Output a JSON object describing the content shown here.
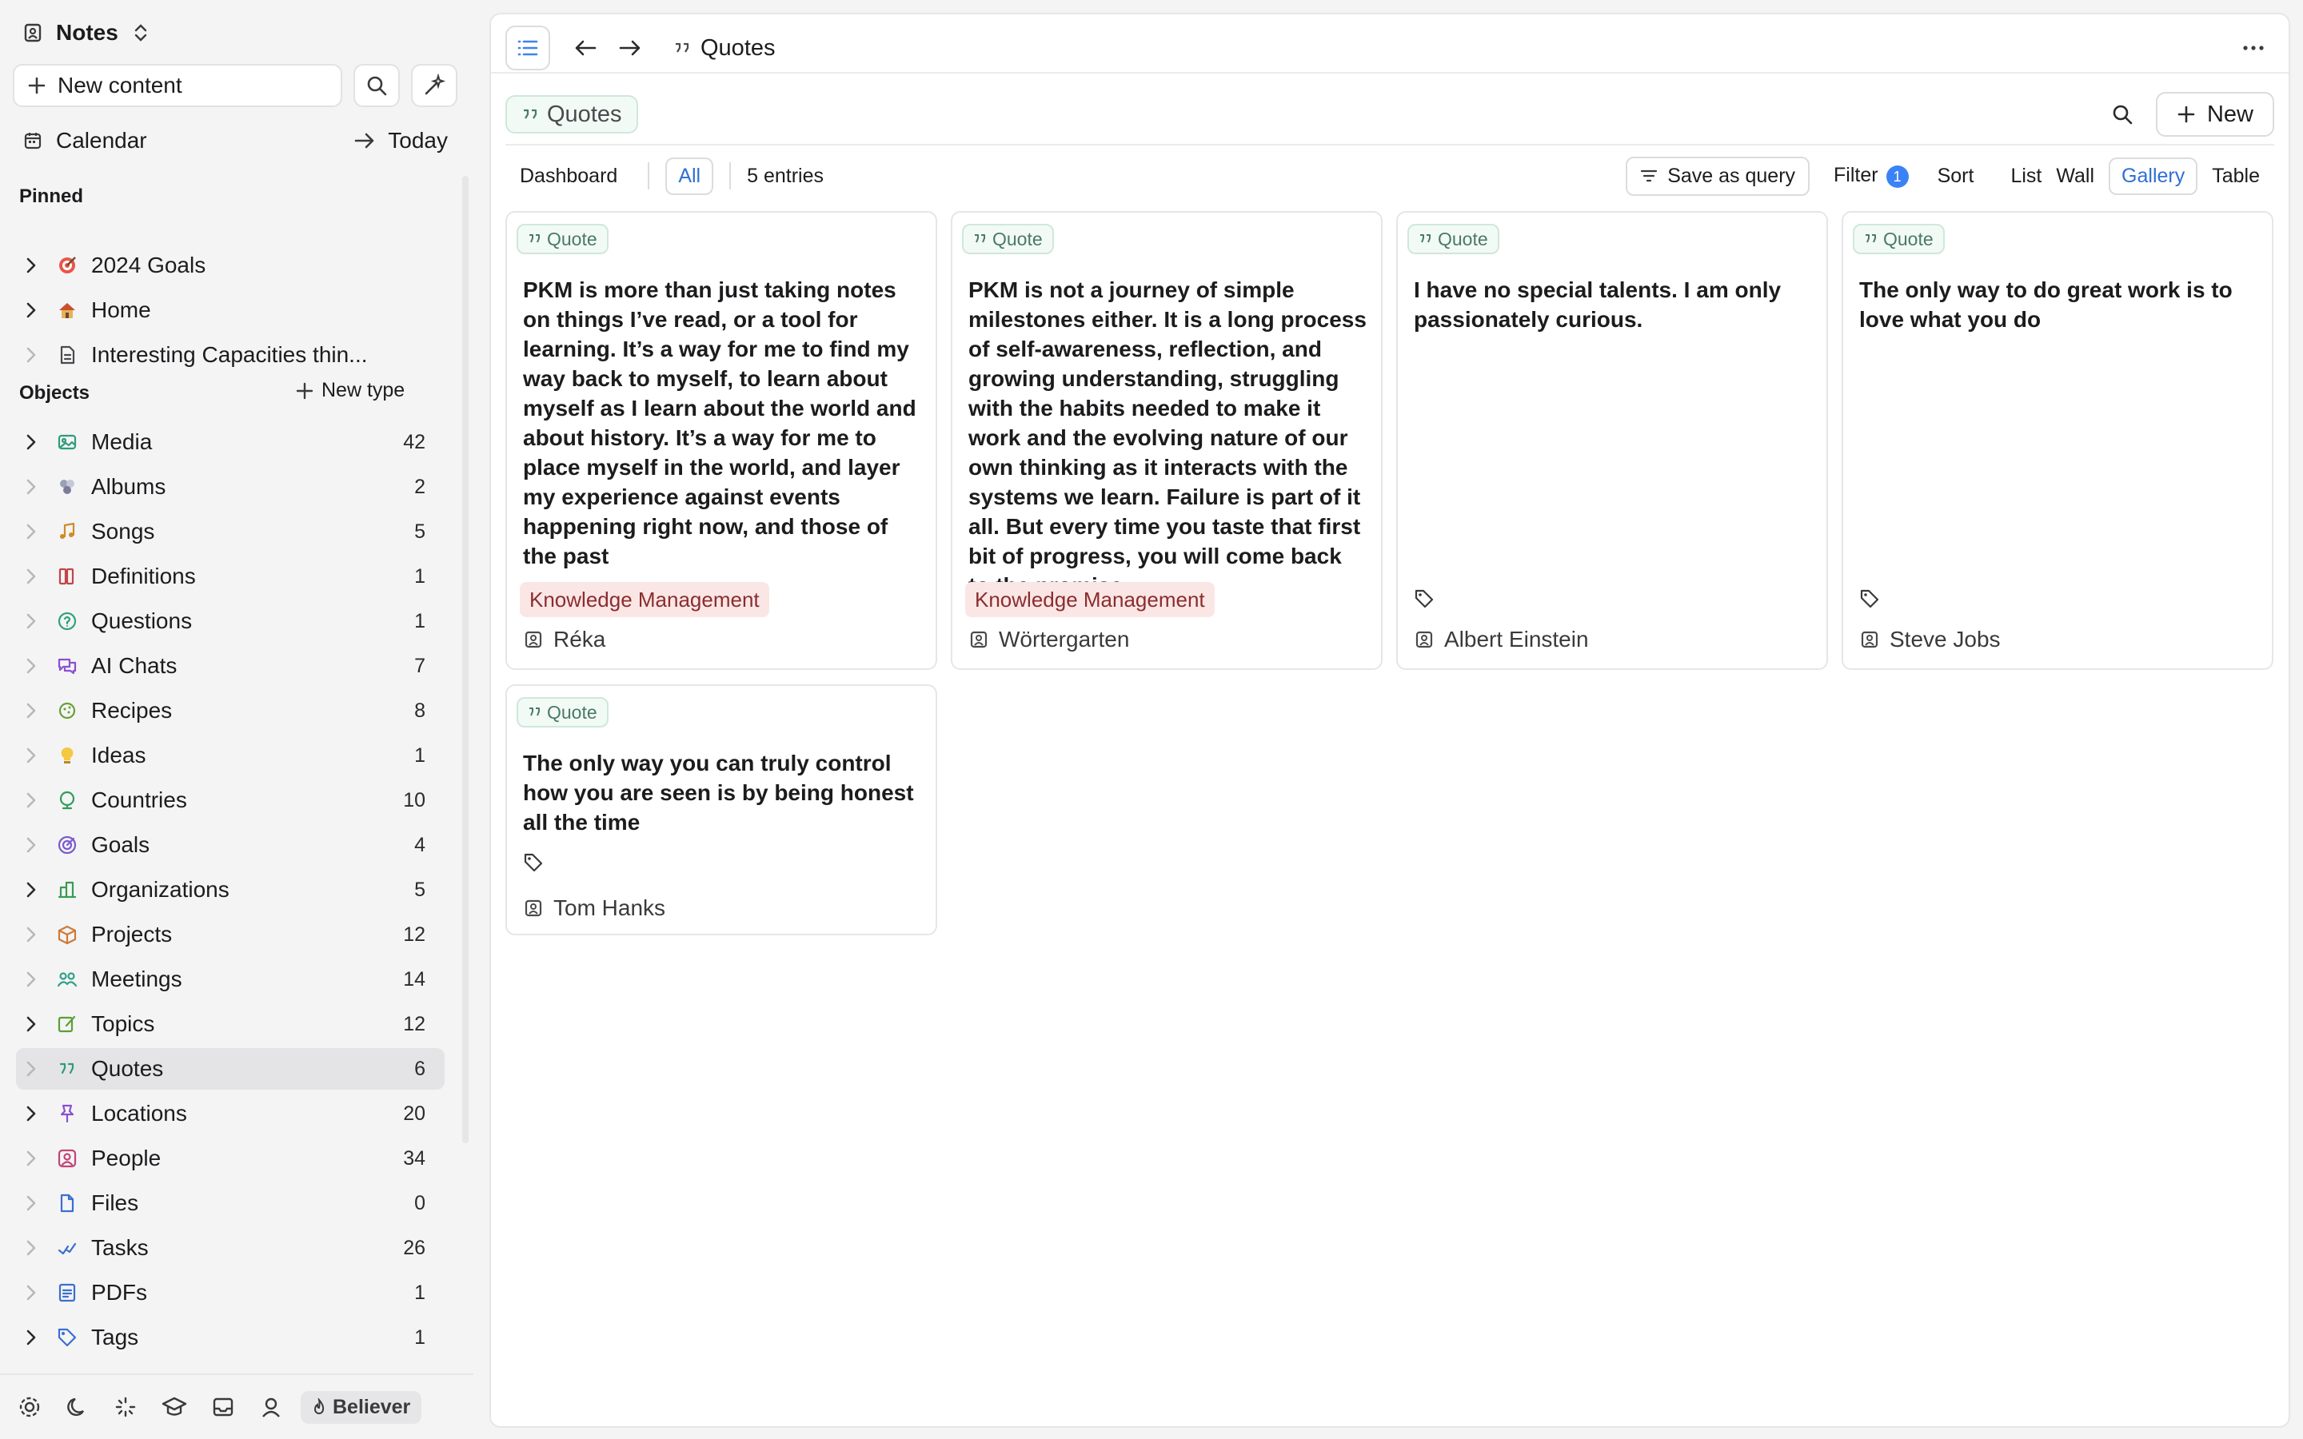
{
  "sidebar": {
    "app_title": "Notes",
    "new_content_label": "New content",
    "calendar_label": "Calendar",
    "today_label": "Today",
    "pinned_title": "Pinned",
    "pinned": [
      {
        "label": "2024 Goals",
        "icon": "target-icon"
      },
      {
        "label": "Home",
        "icon": "house-icon"
      },
      {
        "label": "Interesting Capacities thin...",
        "icon": "document-icon"
      }
    ],
    "objects_title": "Objects",
    "new_type_label": "New type",
    "objects": [
      {
        "label": "Media",
        "count": "42",
        "icon": "media-icon",
        "color": "#2f9c7a"
      },
      {
        "label": "Albums",
        "count": "2",
        "icon": "albums-icon",
        "color": "#7b7b9a"
      },
      {
        "label": "Songs",
        "count": "5",
        "icon": "music-icon",
        "color": "#d08a2a"
      },
      {
        "label": "Definitions",
        "count": "1",
        "icon": "book-icon",
        "color": "#c24545"
      },
      {
        "label": "Questions",
        "count": "1",
        "icon": "question-icon",
        "color": "#2fa37a"
      },
      {
        "label": "AI Chats",
        "count": "7",
        "icon": "chat-icon",
        "color": "#8a4fd0"
      },
      {
        "label": "Recipes",
        "count": "8",
        "icon": "recipe-icon",
        "color": "#6aa035"
      },
      {
        "label": "Ideas",
        "count": "1",
        "icon": "bulb-icon",
        "color": "#e0b020"
      },
      {
        "label": "Countries",
        "count": "10",
        "icon": "globe-icon",
        "color": "#2f9c5a"
      },
      {
        "label": "Goals",
        "count": "4",
        "icon": "goal-icon",
        "color": "#7a5ad0"
      },
      {
        "label": "Organizations",
        "count": "5",
        "icon": "org-icon",
        "color": "#3a9a55"
      },
      {
        "label": "Projects",
        "count": "12",
        "icon": "box-icon",
        "color": "#d07a35"
      },
      {
        "label": "Meetings",
        "count": "14",
        "icon": "people-icon",
        "color": "#2fa08a"
      },
      {
        "label": "Topics",
        "count": "12",
        "icon": "edit-icon",
        "color": "#5aa035"
      },
      {
        "label": "Quotes",
        "count": "6",
        "icon": "quote-icon",
        "color": "#2f9c7a"
      },
      {
        "label": "Locations",
        "count": "20",
        "icon": "pin-icon",
        "color": "#8a4fd0"
      },
      {
        "label": "People",
        "count": "34",
        "icon": "person-icon",
        "color": "#c24575"
      },
      {
        "label": "Files",
        "count": "0",
        "icon": "file-icon",
        "color": "#3a6fd0"
      },
      {
        "label": "Tasks",
        "count": "26",
        "icon": "check-icon",
        "color": "#3a6fd0"
      },
      {
        "label": "PDFs",
        "count": "1",
        "icon": "pdf-icon",
        "color": "#3a6fd0"
      },
      {
        "label": "Tags",
        "count": "1",
        "icon": "tag-icon",
        "color": "#3a6fd0"
      }
    ],
    "active_object": "Quotes",
    "footer_badge": "Believer"
  },
  "main": {
    "breadcrumb": "Quotes",
    "title": "Quotes",
    "new_label": "New",
    "views": {
      "dashboard": "Dashboard",
      "all": "All",
      "entries": "5 entries",
      "save_query": "Save as query",
      "filter": "Filter",
      "filter_count": "1",
      "sort": "Sort",
      "list": "List",
      "wall": "Wall",
      "gallery": "Gallery",
      "table": "Table"
    },
    "cards": [
      {
        "type": "Quote",
        "text": "PKM is more than just taking notes on things I’ve read, or a tool for learning. It’s a way for me to find my way back to myself, to learn about myself as I learn about the world and about history. It’s a way for me to place myself in the world, and layer my experience against events happening right now, and those of the past",
        "tag": "Knowledge Management",
        "author": "Réka"
      },
      {
        "type": "Quote",
        "text": "PKM is not a journey of simple milestones either. It is a long process of self-awareness, reflection, and growing understanding, struggling with the habits needed to make it work and the evolving nature of our own thinking as it interacts with the systems we learn. Failure is part of it all. But every time you taste that first bit of progress, you will come back to the promise.",
        "tag": "Knowledge Management",
        "author": "Wörtergarten"
      },
      {
        "type": "Quote",
        "text": "I have no special talents. I am only passionately curious.",
        "tag": "",
        "author": "Albert Einstein"
      },
      {
        "type": "Quote",
        "text": "The only way to do great work is to love what you do",
        "tag": "",
        "author": "Steve Jobs"
      },
      {
        "type": "Quote",
        "text": "The only way you can truly control how you are seen is by being honest all the time",
        "tag": "",
        "author": "Tom Hanks"
      }
    ]
  }
}
